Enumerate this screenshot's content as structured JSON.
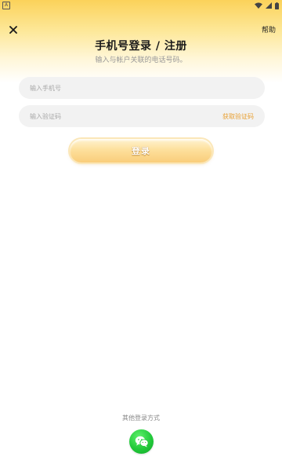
{
  "status_bar": {
    "app_icon_letter": "A",
    "wifi_icon": "wifi-icon",
    "signal_icon": "signal-icon",
    "battery_icon": "battery-icon"
  },
  "header": {
    "close_icon": "close-icon",
    "help_label": "帮助",
    "title": "手机号登录 / 注册",
    "subtitle": "输入与帐户关联的电话号码。"
  },
  "form": {
    "phone_placeholder": "输入手机号",
    "phone_value": "",
    "code_placeholder": "输入验证码",
    "code_value": "",
    "get_code_label": "获取验证码",
    "login_label": "登录"
  },
  "other_login": {
    "title": "其他登录方式",
    "wechat_icon": "wechat-icon"
  },
  "colors": {
    "header_gradient_top": "#fbd25a",
    "accent_orange": "#e8a033",
    "button_gradient": "#fde09d",
    "wechat_green": "#22c93a",
    "input_bg": "#f2f2f2"
  }
}
